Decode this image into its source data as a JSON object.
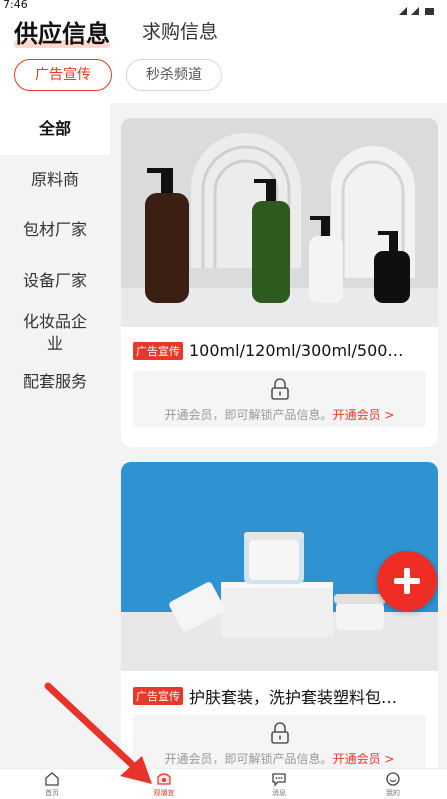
{
  "status": {
    "time": "7:46"
  },
  "tabs": {
    "supply": "供应信息",
    "purchase": "求购信息"
  },
  "chips": {
    "ad": "广告宣传",
    "flash": "秒杀频道"
  },
  "sidebar": {
    "items": [
      {
        "label": "全部"
      },
      {
        "label": "原料商"
      },
      {
        "label": "包材厂家"
      },
      {
        "label": "设备厂家"
      },
      {
        "label": "化妆品企业"
      },
      {
        "label": "配套服务"
      }
    ]
  },
  "cards": [
    {
      "tag": "广告宣传",
      "title": "100ml/120ml/300ml/500ml…",
      "lock_text": "开通会员，即可解锁产品信息。",
      "lock_link": "开通会员 >",
      "image_icon": "pump-bottles-photo"
    },
    {
      "tag": "广告宣传",
      "title": "护肤套装，洗护套装塑料包…",
      "lock_text": "开通会员，即可解锁产品信息。",
      "lock_link": "开通会员 >",
      "image_icon": "cream-jars-photo"
    }
  ],
  "fab": {
    "icon": "plus-icon"
  },
  "bottom_nav": {
    "items": [
      {
        "label": "首页",
        "icon": "home-icon"
      },
      {
        "label": "观潮宣",
        "icon": "guanchao-icon"
      },
      {
        "label": "消息",
        "icon": "message-icon"
      },
      {
        "label": "我的",
        "icon": "profile-icon"
      }
    ]
  },
  "colors": {
    "accent": "#e6392b",
    "fab": "#ef2d24",
    "sidebar_bg": "#f3f3f3",
    "arrow": "#e8332a"
  }
}
